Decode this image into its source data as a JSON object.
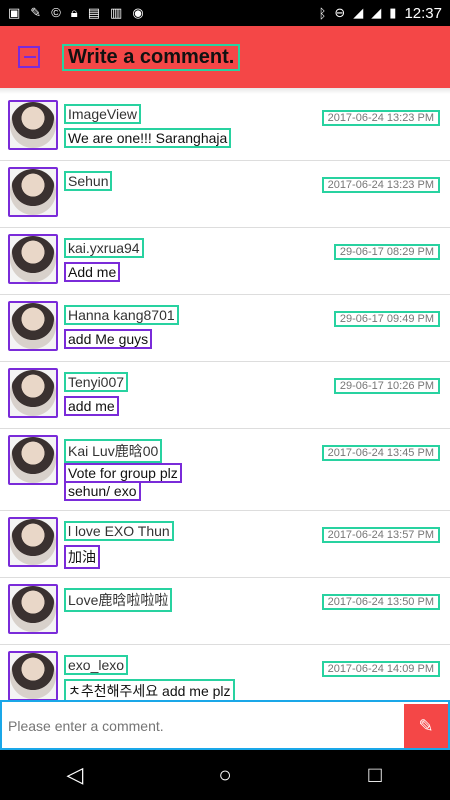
{
  "status": {
    "time": "12:37",
    "icons": [
      "image-icon",
      "wrench-icon",
      "copyright-icon",
      "lock-icon",
      "folder-icon",
      "briefcase-icon",
      "android-icon",
      "bluetooth-icon",
      "do-not-disturb-icon",
      "wifi-icon",
      "signal-icon",
      "battery-icon"
    ]
  },
  "header": {
    "title": "Write a comment."
  },
  "comments": [
    {
      "username": "ImageView",
      "message": "We are one!!! Saranghaja",
      "timestamp": "2017-06-24 13:23 PM"
    },
    {
      "username": "Sehun",
      "message": "",
      "timestamp": "2017-06-24 13:23 PM"
    },
    {
      "username": "kai.yxrua94",
      "message": "Add me",
      "timestamp": "29-06-17 08:29 PM"
    },
    {
      "username": "Hanna kang8701",
      "message": "add Me guys",
      "timestamp": "29-06-17 09:49 PM"
    },
    {
      "username": "Tenyi007",
      "message": "add me",
      "timestamp": "29-06-17 10:26 PM"
    },
    {
      "username": "Kai Luv鹿晗00",
      "message": "Vote for group plz",
      "message2": "sehun/ exo",
      "timestamp": "2017-06-24 13:45 PM"
    },
    {
      "username": "l love EXO Thun",
      "message": "加油",
      "timestamp": "2017-06-24 13:57 PM"
    },
    {
      "username": "Love鹿晗啦啦啦",
      "message": "",
      "timestamp": "2017-06-24 13:50 PM"
    },
    {
      "username": "exo_lexo",
      "message": "ㅊ추천해주세요 add me plz",
      "timestamp": "2017-06-24 14:09 PM"
    }
  ],
  "comment_input": {
    "placeholder": "Please enter a comment."
  },
  "nav": {
    "back": "◁",
    "home": "○",
    "recent": "□"
  }
}
